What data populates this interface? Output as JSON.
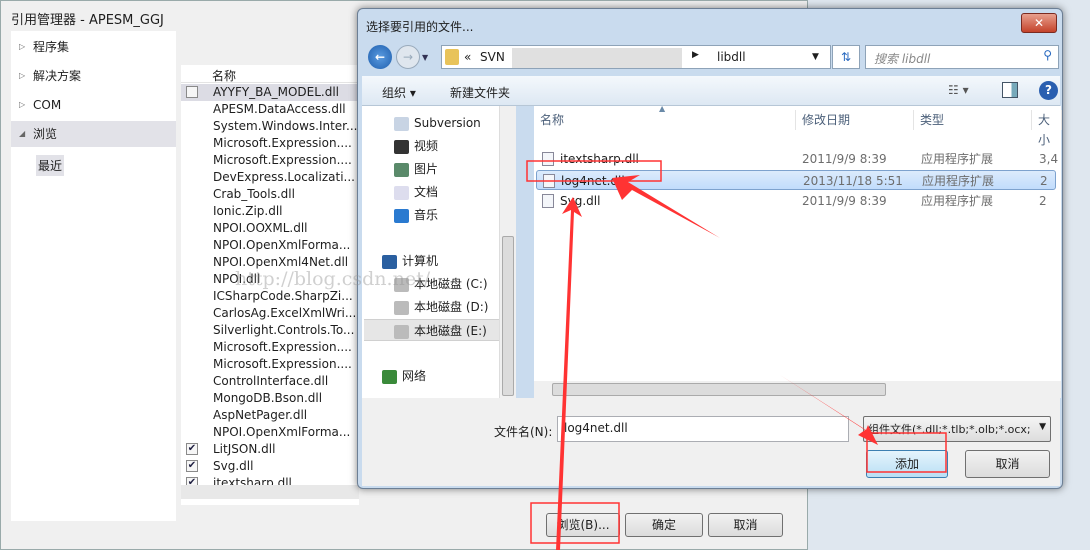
{
  "ref_manager": {
    "title": "引用管理器 - APESM_GGJ",
    "tree": [
      {
        "label": "程序集",
        "expanded": false
      },
      {
        "label": "解决方案",
        "expanded": false
      },
      {
        "label": "COM",
        "expanded": false
      },
      {
        "label": "浏览",
        "expanded": true
      }
    ],
    "tree_child": "最近",
    "column_name": "名称",
    "items": [
      {
        "name": "AYYFY_BA_MODEL.dll",
        "checked": false
      },
      {
        "name": "APESM.DataAccess.dll"
      },
      {
        "name": "System.Windows.Inter..."
      },
      {
        "name": "Microsoft.Expression...."
      },
      {
        "name": "Microsoft.Expression...."
      },
      {
        "name": "DevExpress.Localizati..."
      },
      {
        "name": "Crab_Tools.dll"
      },
      {
        "name": "Ionic.Zip.dll"
      },
      {
        "name": "NPOI.OOXML.dll"
      },
      {
        "name": "NPOI.OpenXmlForma..."
      },
      {
        "name": "NPOI.OpenXml4Net.dll"
      },
      {
        "name": "NPOI.dll"
      },
      {
        "name": "ICSharpCode.SharpZi..."
      },
      {
        "name": "CarlosAg.ExcelXmlWri..."
      },
      {
        "name": "Silverlight.Controls.To..."
      },
      {
        "name": "Microsoft.Expression...."
      },
      {
        "name": "Microsoft.Expression...."
      },
      {
        "name": "ControlInterface.dll"
      },
      {
        "name": "MongoDB.Bson.dll"
      },
      {
        "name": "AspNetPager.dll"
      },
      {
        "name": "NPOI.OpenXmlForma..."
      },
      {
        "name": "LitJSON.dll",
        "checked": true
      },
      {
        "name": "Svg.dll",
        "checked": true
      },
      {
        "name": "itextsharp.dll",
        "checked": true
      }
    ],
    "browse": "浏览(B)...",
    "ok": "确定",
    "cancel": "取消"
  },
  "file_dialog": {
    "title": "选择要引用的文件...",
    "close": "✕",
    "breadcrumb": [
      "«",
      "SVN",
      "libdll"
    ],
    "search_placeholder": "搜索 libdll",
    "organize": "组织 ▾",
    "new_folder": "新建文件夹",
    "nav": [
      {
        "label": "Subversion",
        "icon": "subversion-icon"
      },
      {
        "label": "视频",
        "icon": "video-icon"
      },
      {
        "label": "图片",
        "icon": "pictures-icon"
      },
      {
        "label": "文档",
        "icon": "documents-icon"
      },
      {
        "label": "音乐",
        "icon": "music-icon"
      },
      {
        "label": "计算机",
        "icon": "computer-icon"
      },
      {
        "label": "本地磁盘 (C:)",
        "icon": "drive-icon"
      },
      {
        "label": "本地磁盘 (D:)",
        "icon": "drive-icon"
      },
      {
        "label": "本地磁盘 (E:)",
        "icon": "drive-icon",
        "selected": true
      },
      {
        "label": "网络",
        "icon": "network-icon"
      }
    ],
    "columns": [
      "名称",
      "修改日期",
      "类型",
      "大小"
    ],
    "files": [
      {
        "name": "itextsharp.dll",
        "date": "2011/9/9 8:39",
        "type": "应用程序扩展",
        "size": "3,4"
      },
      {
        "name": "log4net.dll",
        "date": "2013/11/18 5:51",
        "type": "应用程序扩展",
        "size": "2",
        "selected": true
      },
      {
        "name": "Svg.dll",
        "date": "2011/9/9 8:39",
        "type": "应用程序扩展",
        "size": "2"
      }
    ],
    "filename_label": "文件名(N):",
    "filename_value": "log4net.dll",
    "filter": "组件文件(*.dll;*.tlb;*.olb;*.ocx;",
    "add": "添加",
    "cancel": "取消"
  },
  "watermark": "http://blog.csdn.net/",
  "annotation_color": "#ff3333"
}
